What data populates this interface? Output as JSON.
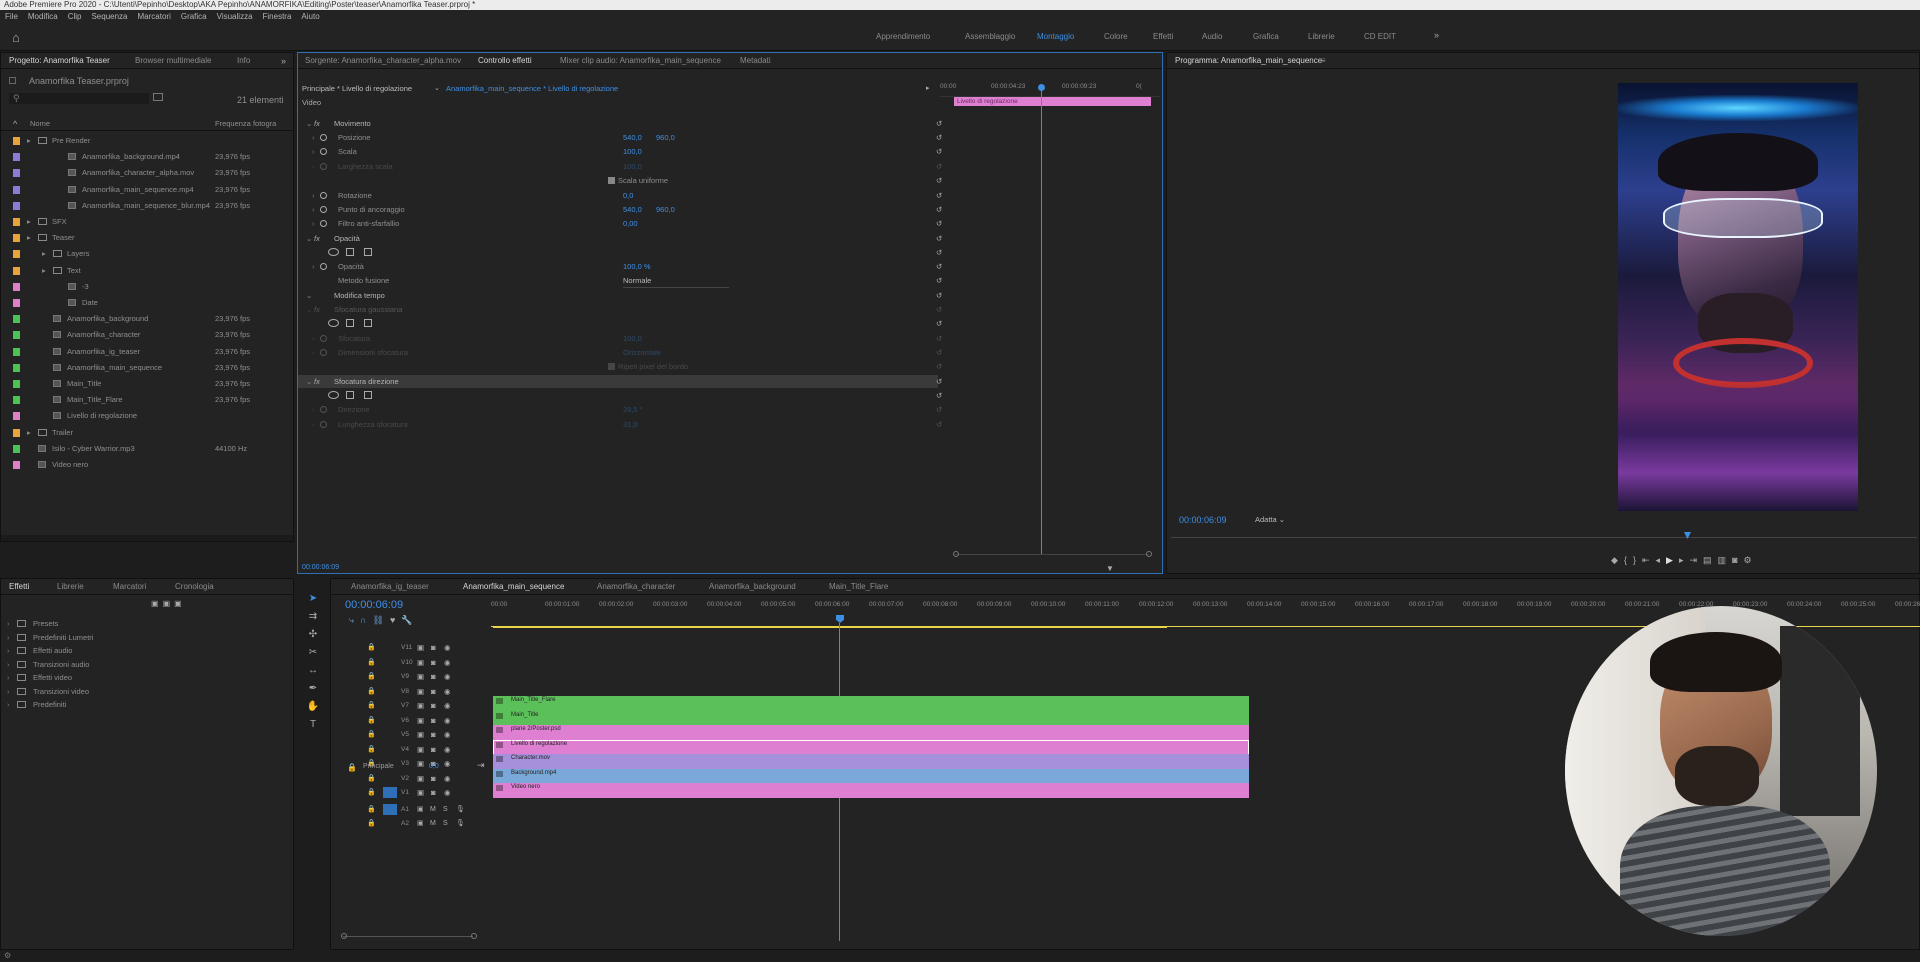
{
  "app": {
    "title": "Adobe Premiere Pro 2020 - C:\\Utenti\\Pepinho\\Desktop\\AKA Pepinho\\ANAMORFIKA\\Editing\\Poster\\teaser\\Anamorfika Teaser.prproj *"
  },
  "menu": [
    "File",
    "Modifica",
    "Clip",
    "Sequenza",
    "Marcatori",
    "Grafica",
    "Visualizza",
    "Finestra",
    "Aiuto"
  ],
  "workspaces": [
    "Apprendimento",
    "Assemblaggio",
    "Montaggio",
    "Colore",
    "Effetti",
    "Audio",
    "Grafica",
    "Librerie",
    "CD EDIT"
  ],
  "workspace_active": "Montaggio",
  "project": {
    "tabs": [
      "Progetto: Anamorfika Teaser",
      "Browser multimediale",
      "Info"
    ],
    "file": "Anamorfika Teaser.prproj",
    "count": "21 elementi",
    "col_name": "Nome",
    "col_rate": "Frequenza fotogra",
    "items": [
      {
        "name": "Pre Render",
        "rate": "",
        "color": "#e8a33b",
        "indent": 1,
        "type": "folder"
      },
      {
        "name": "Anamorfika_background.mp4",
        "rate": "23,976 fps",
        "color": "#8e7bd6",
        "indent": 3,
        "type": "clip"
      },
      {
        "name": "Anamorfika_character_alpha.mov",
        "rate": "23,976 fps",
        "color": "#8e7bd6",
        "indent": 3,
        "type": "clip"
      },
      {
        "name": "Anamorfika_main_sequence.mp4",
        "rate": "23,976 fps",
        "color": "#8e7bd6",
        "indent": 3,
        "type": "clip"
      },
      {
        "name": "Anamorfika_main_sequence_blur.mp4",
        "rate": "23,976 fps",
        "color": "#8e7bd6",
        "indent": 3,
        "type": "clip"
      },
      {
        "name": "SFX",
        "rate": "",
        "color": "#e8a33b",
        "indent": 1,
        "type": "folder"
      },
      {
        "name": "Teaser",
        "rate": "",
        "color": "#e8a33b",
        "indent": 1,
        "type": "folder"
      },
      {
        "name": "Layers",
        "rate": "",
        "color": "#e8a33b",
        "indent": 2,
        "type": "folder"
      },
      {
        "name": "Text",
        "rate": "",
        "color": "#e8a33b",
        "indent": 2,
        "type": "folder"
      },
      {
        "name": "-3",
        "rate": "",
        "color": "#e080c8",
        "indent": 3,
        "type": "text"
      },
      {
        "name": "Date",
        "rate": "",
        "color": "#e080c8",
        "indent": 3,
        "type": "text"
      },
      {
        "name": "Anamorfika_background",
        "rate": "23,976 fps",
        "color": "#4cc455",
        "indent": 2,
        "type": "seq"
      },
      {
        "name": "Anamorfika_character",
        "rate": "23,976 fps",
        "color": "#4cc455",
        "indent": 2,
        "type": "seq"
      },
      {
        "name": "Anamorfika_ig_teaser",
        "rate": "23,976 fps",
        "color": "#4cc455",
        "indent": 2,
        "type": "seq"
      },
      {
        "name": "Anamorfika_main_sequence",
        "rate": "23,976 fps",
        "color": "#4cc455",
        "indent": 2,
        "type": "seq"
      },
      {
        "name": "Main_Title",
        "rate": "23,976 fps",
        "color": "#4cc455",
        "indent": 2,
        "type": "seq"
      },
      {
        "name": "Main_Title_Flare",
        "rate": "23,976 fps",
        "color": "#4cc455",
        "indent": 2,
        "type": "seq"
      },
      {
        "name": "Livello di regolazione",
        "rate": "",
        "color": "#e080c8",
        "indent": 2,
        "type": "text"
      },
      {
        "name": "Trailer",
        "rate": "",
        "color": "#e8a33b",
        "indent": 1,
        "type": "folder"
      },
      {
        "name": "Isilo - Cyber Warrior.mp3",
        "rate": "44100 Hz",
        "color": "#4cc455",
        "indent": 1,
        "type": "audio"
      },
      {
        "name": "Video nero",
        "rate": "",
        "color": "#e080c8",
        "indent": 1,
        "type": "text"
      }
    ]
  },
  "effects": {
    "tabs": [
      "Sorgente: Anamorfika_character_alpha.mov",
      "Controllo effetti",
      "Mixer clip audio: Anamorfika_main_sequence",
      "Metadati"
    ],
    "master": "Principale * Livello di regolazione",
    "seq": "Anamorfika_main_sequence * Livello di regolazione",
    "ruler": [
      "00:00",
      "00:00:04:23",
      "00:00:09:23",
      "0("
    ],
    "clip_label": "Livello di regolazione",
    "video_label": "Video",
    "rows": [
      {
        "label": "Movimento",
        "v1": "",
        "v2": "",
        "lvl": 1,
        "fx": true
      },
      {
        "label": "Posizione",
        "v1": "540,0",
        "v2": "960,0",
        "lvl": 2
      },
      {
        "label": "Scala",
        "v1": "100,0",
        "v2": "",
        "lvl": 2
      },
      {
        "label": "Larghezza scala",
        "v1": "100,0",
        "v2": "",
        "lvl": 2,
        "dim": true
      },
      {
        "label": "Scala uniforme",
        "v1": "",
        "v2": "",
        "lvl": 3,
        "check": true
      },
      {
        "label": "Rotazione",
        "v1": "0,0",
        "v2": "",
        "lvl": 2
      },
      {
        "label": "Punto di ancoraggio",
        "v1": "540,0",
        "v2": "960,0",
        "lvl": 2
      },
      {
        "label": "Filtro anti-sfarfallio",
        "v1": "0,00",
        "v2": "",
        "lvl": 2
      },
      {
        "label": "Opacità",
        "v1": "",
        "v2": "",
        "lvl": 1,
        "fx": true
      },
      {
        "label": "",
        "v1": "",
        "v2": "",
        "lvl": 2,
        "masks": true
      },
      {
        "label": "Opacità",
        "v1": "100,0 %",
        "v2": "",
        "lvl": 2
      },
      {
        "label": "Metodo fusione",
        "v1": "Normale",
        "v2": "",
        "lvl": 2,
        "select": true
      },
      {
        "label": "Modifica tempo",
        "v1": "",
        "v2": "",
        "lvl": 1
      },
      {
        "label": "Sfocatura gaussiana",
        "v1": "",
        "v2": "",
        "lvl": 1,
        "fx": true,
        "dim": true
      },
      {
        "label": "",
        "v1": "",
        "v2": "",
        "lvl": 2,
        "masks": true
      },
      {
        "label": "Sfocatura",
        "v1": "100,0",
        "v2": "",
        "lvl": 2,
        "dim": true
      },
      {
        "label": "Dimensioni sfocatura",
        "v1": "Orizzontale",
        "v2": "",
        "lvl": 2,
        "dim": true
      },
      {
        "label": "Ripeti pixel del bordo",
        "v1": "",
        "v2": "",
        "lvl": 3,
        "dim": true,
        "check": true
      },
      {
        "label": "Sfocatura direzione",
        "v1": "",
        "v2": "",
        "lvl": 1,
        "fx": true,
        "sel": true
      },
      {
        "label": "",
        "v1": "",
        "v2": "",
        "lvl": 2,
        "masks": true
      },
      {
        "label": "Direzione",
        "v1": "28,5 °",
        "v2": "",
        "lvl": 2,
        "dim": true
      },
      {
        "label": "Lunghezza sfocatura",
        "v1": "31,0",
        "v2": "",
        "lvl": 2,
        "dim": true
      }
    ],
    "time": "00:00:06:09"
  },
  "program": {
    "tab": "Programma: Anamorfika_main_sequence",
    "time": "00:00:06:09",
    "zoom": "Adatta"
  },
  "fxpanel": {
    "tabs": [
      "Effetti",
      "Librerie",
      "Marcatori",
      "Cronologia"
    ],
    "items": [
      "Presets",
      "Predefiniti Lumetri",
      "Effetti audio",
      "Transizioni audio",
      "Effetti video",
      "Transizioni video",
      "Predefiniti"
    ]
  },
  "timeline": {
    "tabs": [
      "Anamorfika_ig_teaser",
      "Anamorfika_main_sequence",
      "Anamorfika_character",
      "Anamorfika_background",
      "Main_Title_Flare"
    ],
    "active_tab": 1,
    "time": "00:00:06:09",
    "ruler": [
      "00:00",
      "00:00:01:00",
      "00:00:02:00",
      "00:00:03:00",
      "00:00:04:00",
      "00:00:05:00",
      "00:00:06:00",
      "00:00:07:00",
      "00:00:08:00",
      "00:00:09:00",
      "00:00:10:00",
      "00:00:11:00",
      "00:00:12:00",
      "00:00:13:00",
      "00:00:14:00",
      "00:00:15:00",
      "00:00:16:00",
      "00:00:17:00",
      "00:00:18:00",
      "00:00:19:00",
      "00:00:20:00",
      "00:00:21:00",
      "00:00:22:00",
      "00:00:23:00",
      "00:00:24:00",
      "00:00:25:00",
      "00:00:26:00"
    ],
    "tracks": [
      "V11",
      "V10",
      "V9",
      "V8",
      "V7",
      "V6",
      "V5",
      "V4",
      "V3",
      "V2",
      "V1",
      "A1",
      "A2"
    ],
    "master_label": "Principale",
    "master_val": "0,0",
    "clips": [
      {
        "name": "Main_Title_Flare",
        "track": "V7",
        "color": "#5cc05a"
      },
      {
        "name": "Main_Title",
        "track": "V6",
        "color": "#5cc05a"
      },
      {
        "name": "plane 2/Poster.psd",
        "track": "V5",
        "color": "#df7fd2"
      },
      {
        "name": "Livello di regolazione",
        "track": "V4",
        "color": "#df7fd2"
      },
      {
        "name": "Character.mov",
        "track": "V3",
        "color": "#a690dc"
      },
      {
        "name": "Background.mp4",
        "track": "V2",
        "color": "#7aa8d8"
      },
      {
        "name": "Video nero",
        "track": "V1",
        "color": "#df7fd2"
      }
    ]
  }
}
